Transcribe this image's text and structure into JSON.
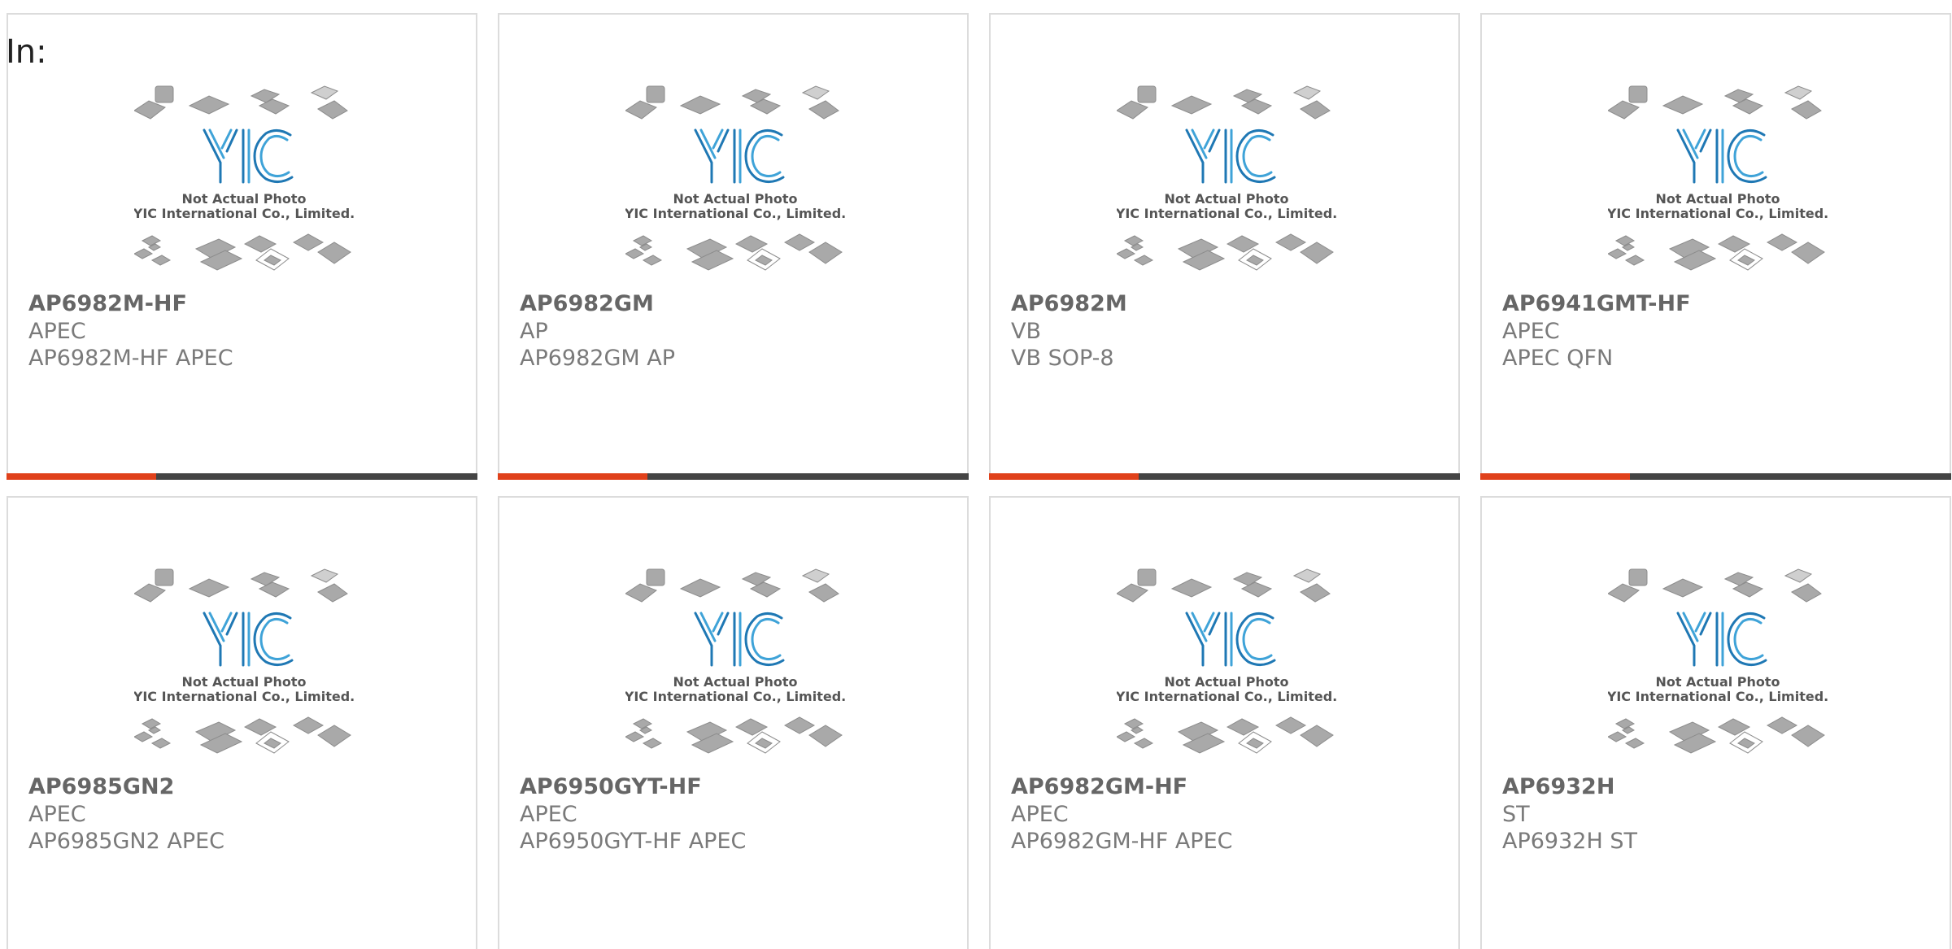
{
  "page": {
    "label": "In:"
  },
  "colors": {
    "accent": "#e0411b",
    "bar_dark": "#444444",
    "logo_blue": "#1f78b4"
  },
  "photo_placeholder": {
    "logo_text": "YIC",
    "caption_line1": "Not Actual Photo",
    "caption_line2": "YIC International Co., Limited."
  },
  "products": [
    {
      "name": "AP6982M-HF",
      "brand": "APEC",
      "desc": "AP6982M-HF APEC"
    },
    {
      "name": "AP6982GM",
      "brand": "AP",
      "desc": "AP6982GM AP"
    },
    {
      "name": "AP6982M",
      "brand": "VB",
      "desc": "VB SOP-8"
    },
    {
      "name": "AP6941GMT-HF",
      "brand": "APEC",
      "desc": "APEC QFN"
    },
    {
      "name": "AP6985GN2",
      "brand": "APEC",
      "desc": "AP6985GN2 APEC"
    },
    {
      "name": "AP6950GYT-HF",
      "brand": "APEC",
      "desc": "AP6950GYT-HF APEC"
    },
    {
      "name": "AP6982GM-HF",
      "brand": "APEC",
      "desc": "AP6982GM-HF APEC"
    },
    {
      "name": "AP6932H",
      "brand": "ST",
      "desc": "AP6932H ST"
    }
  ]
}
